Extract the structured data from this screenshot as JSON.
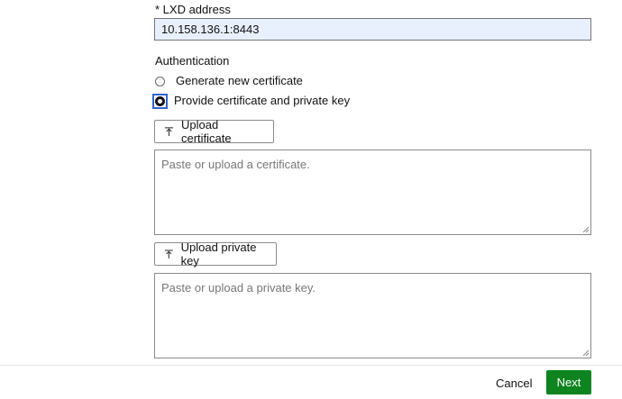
{
  "lxd_address": {
    "label": "* LXD address",
    "value": "10.158.136.1:8443"
  },
  "authentication": {
    "label": "Authentication",
    "options": [
      {
        "label": "Generate new certificate",
        "selected": false
      },
      {
        "label": "Provide certificate and private key",
        "selected": true
      }
    ]
  },
  "certificate": {
    "upload_label": "Upload certificate",
    "placeholder": "Paste or upload a certificate."
  },
  "private_key": {
    "upload_label": "Upload private key",
    "placeholder": "Paste or upload a private key."
  },
  "footer": {
    "cancel_label": "Cancel",
    "next_label": "Next",
    "next_color": "#0e8420"
  },
  "icons": {
    "upload": "upload-icon",
    "resize": "resize-grip-icon"
  }
}
